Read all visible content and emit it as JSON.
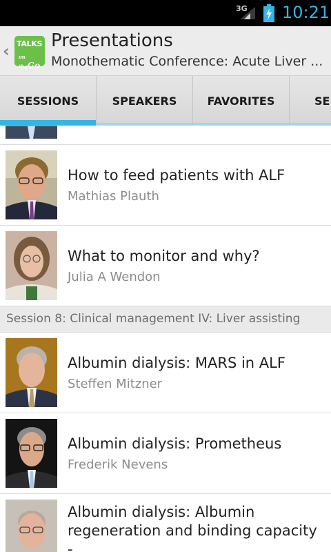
{
  "status": {
    "network": "3G",
    "time": "10:21"
  },
  "actionbar": {
    "logo_line1": "TALKS",
    "logo_on": "on the",
    "logo_go": "Go",
    "title": "Presentations",
    "subtitle": "Monothematic Conference: Acute Liver ..."
  },
  "tabs": [
    {
      "label": "SESSIONS",
      "selected": true
    },
    {
      "label": "SPEAKERS",
      "selected": false
    },
    {
      "label": "FAVORITES",
      "selected": false
    },
    {
      "label": "SE",
      "selected": false
    }
  ],
  "list": {
    "items1": [
      {
        "title": "How to feed patients with ALF",
        "speaker": "Mathias Plauth"
      },
      {
        "title": "What to monitor and why?",
        "speaker": "Julia A Wendon"
      }
    ],
    "session_header": "Session 8: Clinical management IV: Liver assisting",
    "items2": [
      {
        "title": "Albumin dialysis: MARS in ALF",
        "speaker": "Steffen Mitzner"
      },
      {
        "title": "Albumin dialysis: Prometheus",
        "speaker": "Frederik Nevens"
      },
      {
        "title_line1": "Albumin dialysis: Albumin",
        "title_line2": "regeneration and binding capacity -"
      }
    ]
  },
  "colors": {
    "accent": "#33b5e5",
    "logo_green": "#6cc04a"
  }
}
